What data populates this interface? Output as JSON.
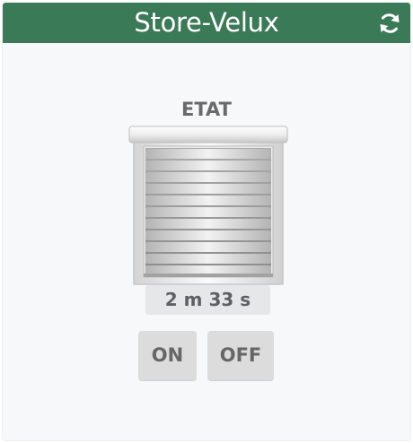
{
  "widget": {
    "title": "Store-Velux",
    "header_color": "#3b7a57",
    "refresh_icon": "refresh-icon"
  },
  "status": {
    "label": "ETAT",
    "shutter_icon": "roller-shutter-icon",
    "shutter_state": "closed",
    "duration": "2 m 33 s"
  },
  "controls": {
    "on_label": "ON",
    "off_label": "OFF"
  }
}
